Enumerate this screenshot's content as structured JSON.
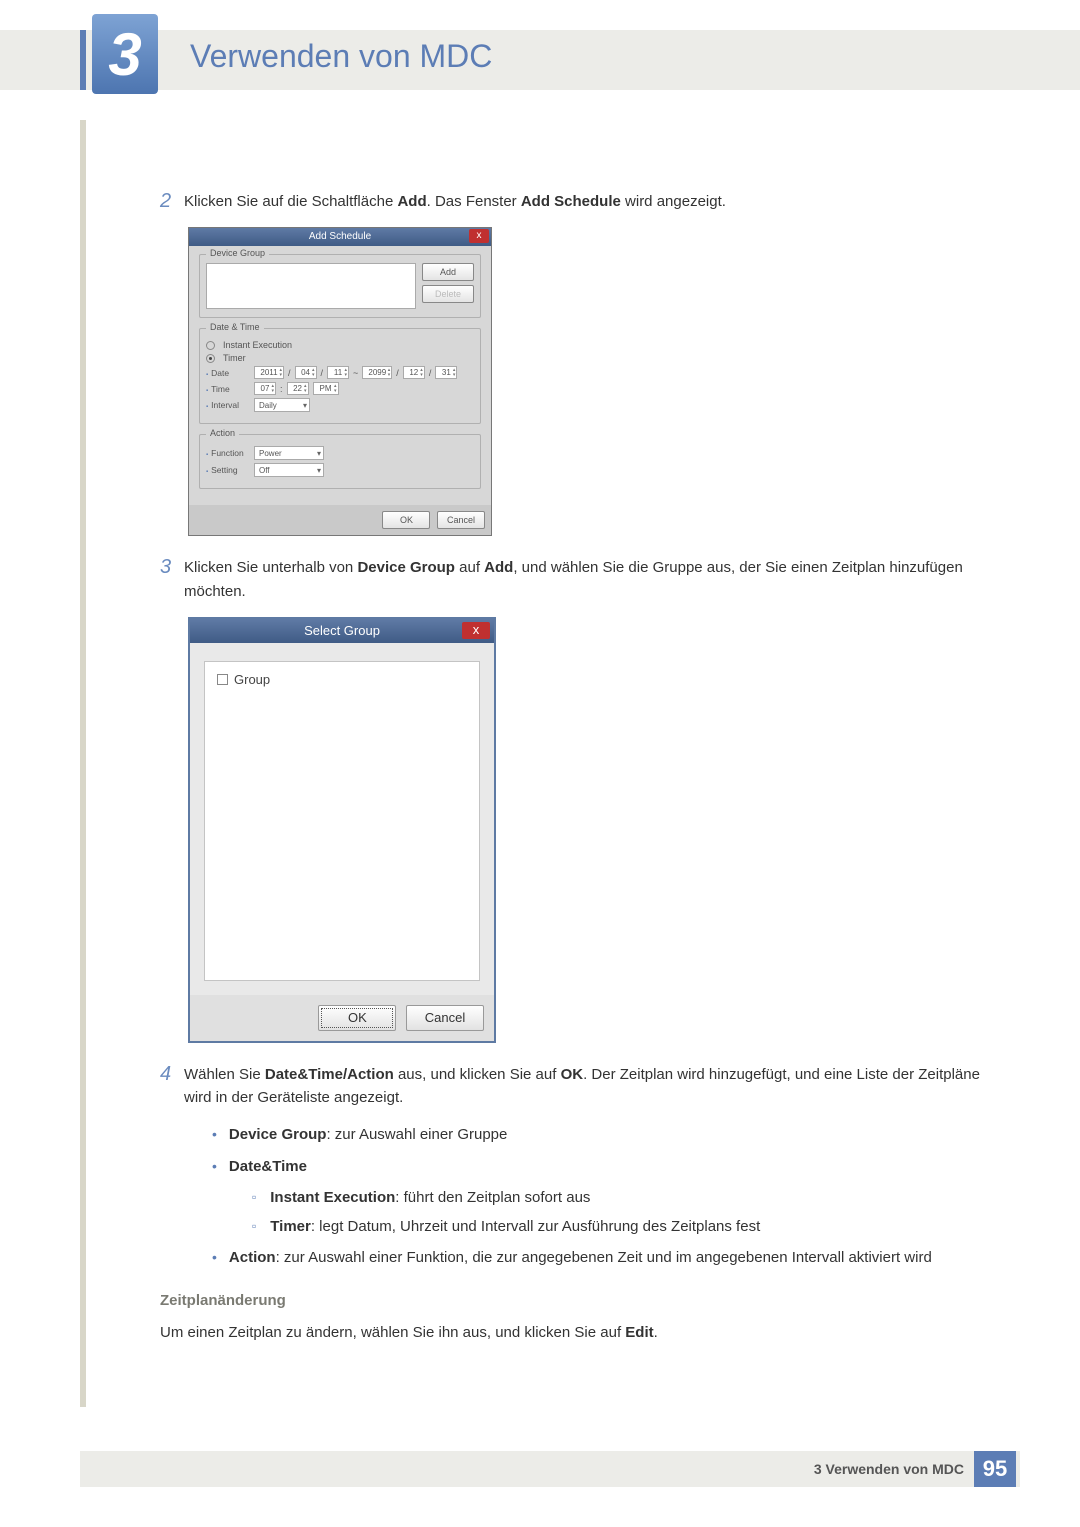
{
  "chapter": {
    "number": "3",
    "title": "Verwenden von MDC"
  },
  "steps": {
    "s2": {
      "num": "2",
      "pre": "Klicken Sie auf die Schaltfläche ",
      "b1": "Add",
      "mid": ". Das Fenster ",
      "b2": "Add Schedule",
      "post": " wird angezeigt."
    },
    "s3": {
      "num": "3",
      "pre": "Klicken Sie unterhalb von ",
      "b1": "Device Group",
      "mid": " auf ",
      "b2": "Add",
      "post": ", und wählen Sie die Gruppe aus, der Sie einen Zeitplan hinzufügen möchten."
    },
    "s4": {
      "num": "4",
      "pre": "Wählen Sie ",
      "b1": "Date&Time/Action",
      "mid": " aus, und klicken Sie auf ",
      "b2": "OK",
      "post": ". Der Zeitplan wird hinzugefügt, und eine Liste der Zeitpläne wird in der Geräteliste angezeigt."
    }
  },
  "addSchedule": {
    "title": "Add Schedule",
    "deviceGroup": {
      "legend": "Device Group",
      "add": "Add",
      "delete": "Delete"
    },
    "dateTime": {
      "legend": "Date & Time",
      "instant": "Instant Execution",
      "timer": "Timer",
      "dateLabel": "Date",
      "dateFrom": {
        "y": "2011",
        "m": "04",
        "d": "11"
      },
      "dateTo": {
        "y": "2099",
        "m": "12",
        "d": "31"
      },
      "sep1": "/",
      "sep2": "/",
      "tilde": "~",
      "timeLabel": "Time",
      "time_h": "07",
      "time_m": "22",
      "time_ampm": "PM",
      "intervalLabel": "Interval",
      "interval": "Daily"
    },
    "action": {
      "legend": "Action",
      "functionLabel": "Function",
      "function": "Power",
      "settingLabel": "Setting",
      "setting": "Off"
    },
    "ok": "OK",
    "cancel": "Cancel"
  },
  "selectGroup": {
    "title": "Select Group",
    "root": "Group",
    "ok": "OK",
    "cancel": "Cancel"
  },
  "bullets": {
    "b1": {
      "bold": "Device Group",
      "rest": ": zur Auswahl einer Gruppe"
    },
    "b2": {
      "bold": "Date&Time"
    },
    "b2a": {
      "bold": "Instant Execution",
      "rest": ": führt den Zeitplan sofort aus"
    },
    "b2b": {
      "bold": "Timer",
      "rest": ": legt Datum, Uhrzeit und Intervall zur Ausführung des Zeitplans fest"
    },
    "b3": {
      "bold": "Action",
      "rest": ": zur Auswahl einer Funktion, die zur angegebenen Zeit und im angegebenen Intervall aktiviert wird"
    }
  },
  "subsection": "Zeitplanänderung",
  "editLine": {
    "pre": "Um einen Zeitplan zu ändern, wählen Sie ihn aus, und klicken Sie auf ",
    "bold": "Edit",
    "post": "."
  },
  "footer": {
    "text": "3 Verwenden von MDC",
    "page": "95"
  }
}
